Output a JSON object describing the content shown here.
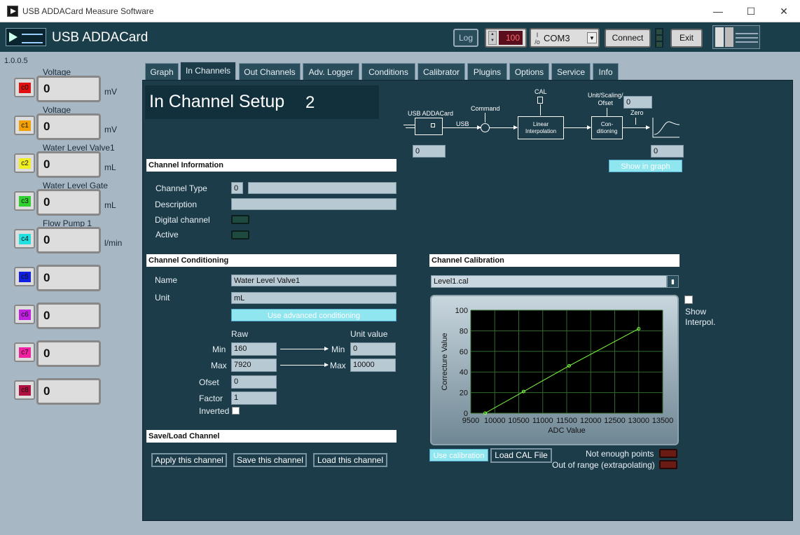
{
  "window": {
    "title": "USB ADDACard Measure Software",
    "controls": [
      "—",
      "☐",
      "✕"
    ]
  },
  "header": {
    "brand": "USB ADDACard",
    "log_label": "Log",
    "counter_value": "100",
    "port_value": "COM3",
    "connect_label": "Connect",
    "exit_label": "Exit"
  },
  "sidebar": {
    "version": "1.0.0.5",
    "channels": [
      {
        "tag": "c0",
        "title": "Voltage",
        "value": "0",
        "unit": "mV",
        "color": "#e01010"
      },
      {
        "tag": "c1",
        "title": "Voltage",
        "value": "0",
        "unit": "mV",
        "color": "#f4a000"
      },
      {
        "tag": "c2",
        "title": "Water Level Valve1",
        "value": "0",
        "unit": "mL",
        "color": "#f0f020"
      },
      {
        "tag": "c3",
        "title": "Water Level Gate",
        "value": "0",
        "unit": "mL",
        "color": "#30d030"
      },
      {
        "tag": "c4",
        "title": "Flow Pump 1",
        "value": "0",
        "unit": "l/min",
        "color": "#20e0e0"
      },
      {
        "tag": "c5",
        "title": "",
        "value": "0",
        "unit": "",
        "color": "#1020e0"
      },
      {
        "tag": "c6",
        "title": "",
        "value": "0",
        "unit": "",
        "color": "#c020e0"
      },
      {
        "tag": "c7",
        "title": "",
        "value": "0",
        "unit": "",
        "color": "#f020a0"
      },
      {
        "tag": "c8",
        "title": "",
        "value": "0",
        "unit": "",
        "color": "#b01040"
      }
    ]
  },
  "tabs": [
    "Graph",
    "In Channels",
    "Out Channels",
    "Adv. Logger",
    "Conditions",
    "Calibrator",
    "Plugins",
    "Options",
    "Service",
    "Info"
  ],
  "setup": {
    "title": "In Channel Setup",
    "channel_number": "2"
  },
  "diagram": {
    "usb_label": "USB ADDACard",
    "usb_link": "USB",
    "command_label": "Command",
    "cal_label": "CAL",
    "interp_label": "Linear\nInterpolation",
    "unit_label": "Unit/Scaling/\nOfset",
    "unit_value": "0",
    "zero_label": "Zero",
    "cond_label": "Con-\nditioning",
    "raw_value": "0",
    "out_value": "0",
    "show_in_graph": "Show in graph"
  },
  "channel_info": {
    "header": "Channel Information",
    "type_label": "Channel Type",
    "type_value": "0",
    "type_name": "",
    "desc_label": "Description",
    "desc_value": "",
    "digital_label": "Digital channel",
    "active_label": "Active"
  },
  "conditioning": {
    "header": "Channel Conditioning",
    "name_label": "Name",
    "name_value": "Water Level Valve1",
    "unit_label": "Unit",
    "unit_value": "mL",
    "advanced_label": "Use advanced conditioning",
    "raw_header": "Raw",
    "unit_header": "Unit value",
    "min_label": "Min",
    "max_label": "Max",
    "raw_min": "160",
    "raw_max": "7920",
    "unit_min_label": "Min",
    "unit_max_label": "Max",
    "unit_min": "0",
    "unit_max": "10000",
    "ofset_label": "Ofset",
    "ofset_value": "0",
    "factor_label": "Factor",
    "factor_value": "1",
    "inverted_label": "Inverted"
  },
  "save_load": {
    "header": "Save/Load Channel",
    "apply_label": "Apply this channel",
    "save_label": "Save this channel",
    "load_label": "Load this channel"
  },
  "calibration": {
    "header": "Channel Calibration",
    "file_value": "Level1.cal",
    "show_interp_label": "Show\nInterpol.",
    "use_cal_label": "Use calibration",
    "load_cal_label": "Load CAL File",
    "not_enough_label": "Not enough points",
    "out_of_range_label": "Out of range (extrapolating)"
  },
  "chart_data": {
    "type": "line",
    "xlabel": "ADC Value",
    "ylabel": "Correcture Value",
    "xlim": [
      9500,
      13500
    ],
    "ylim": [
      0,
      100
    ],
    "xticks": [
      9500,
      10000,
      10500,
      11000,
      11500,
      12000,
      12500,
      13000,
      13500
    ],
    "yticks": [
      0,
      20,
      40,
      60,
      80,
      100
    ],
    "series": [
      {
        "points": [
          [
            9800,
            0
          ],
          [
            10600,
            21
          ],
          [
            11550,
            46
          ],
          [
            13000,
            82
          ]
        ],
        "color": "#80ff40"
      }
    ],
    "grid": true
  }
}
